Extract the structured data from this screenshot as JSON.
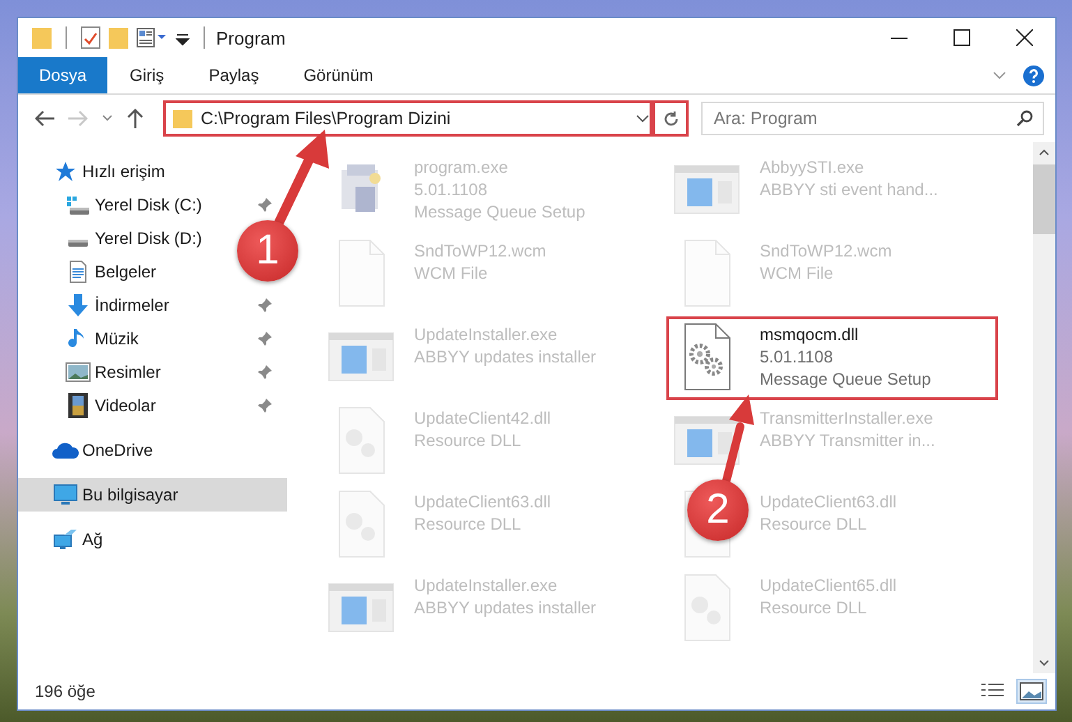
{
  "window": {
    "title": "Program"
  },
  "ribbon": {
    "tabs": [
      {
        "label": "Dosya",
        "selected": true
      },
      {
        "label": "Giriş",
        "selected": false
      },
      {
        "label": "Paylaş",
        "selected": false
      },
      {
        "label": "Görünüm",
        "selected": false
      }
    ]
  },
  "address_bar": {
    "path": "C:\\Program Files\\Program Dizini",
    "highlighted": true
  },
  "search": {
    "placeholder": "Ara: Program"
  },
  "nav_pane": {
    "items": [
      {
        "label": "Hızlı erişim",
        "kind": "star",
        "pinned": false,
        "selected": false,
        "children": [
          {
            "label": "Yerel Disk (C:)",
            "kind": "system-drive",
            "pinned": true,
            "selected": false
          },
          {
            "label": "Yerel Disk (D:)",
            "kind": "drive",
            "selected": false
          },
          {
            "label": "Belgeler",
            "kind": "documents",
            "selected": false
          },
          {
            "label": "İndirmeler",
            "kind": "downloads",
            "pinned": true,
            "selected": false
          },
          {
            "label": "Müzik",
            "kind": "music",
            "pinned": true,
            "selected": false
          },
          {
            "label": "Resimler",
            "kind": "pictures",
            "pinned": true,
            "selected": false
          },
          {
            "label": "Videolar",
            "kind": "videos",
            "pinned": true,
            "selected": false
          }
        ]
      },
      {
        "label": "OneDrive",
        "kind": "cloud",
        "pinned": false,
        "selected": false
      },
      {
        "label": "Bu bilgisayar",
        "kind": "computer",
        "pinned": false,
        "selected": true
      },
      {
        "label": "Ağ",
        "kind": "network",
        "pinned": false,
        "selected": false
      }
    ]
  },
  "files": [
    {
      "name": "program.exe",
      "details": [
        "5.01.1108",
        "Message Queue Setup"
      ],
      "kind": "setup",
      "blurred": true,
      "highlighted": false
    },
    {
      "name": "AbbyySTI.exe",
      "details": [
        "ABBYY sti event hand..."
      ],
      "kind": "app",
      "blurred": true,
      "highlighted": false
    },
    {
      "name": "SndToWP12.wcm",
      "details": [
        "WCM File"
      ],
      "kind": "blank",
      "blurred": true,
      "highlighted": false
    },
    {
      "name": "SndToWP12.wcm",
      "details": [
        "WCM File"
      ],
      "kind": "blank",
      "blurred": true,
      "highlighted": false
    },
    {
      "name": "UpdateInstaller.exe",
      "details": [
        "ABBYY updates installer"
      ],
      "kind": "app",
      "blurred": true,
      "highlighted": false
    },
    {
      "name": "msmqocm.dll",
      "details": [
        "5.01.1108",
        "Message Queue Setup"
      ],
      "kind": "gear",
      "blurred": false,
      "highlighted": true
    },
    {
      "name": "UpdateClient42.dll",
      "details": [
        "Resource DLL"
      ],
      "kind": "key",
      "blurred": true,
      "highlighted": false
    },
    {
      "name": "TransmitterInstaller.exe",
      "details": [
        "ABBYY Transmitter in..."
      ],
      "kind": "app",
      "blurred": true,
      "highlighted": false
    },
    {
      "name": "UpdateClient63.dll",
      "details": [
        "Resource DLL"
      ],
      "kind": "key",
      "blurred": true,
      "highlighted": false
    },
    {
      "name": "UpdateClient63.dll",
      "details": [
        "Resource DLL"
      ],
      "kind": "key",
      "blurred": true,
      "highlighted": false
    },
    {
      "name": "UpdateInstaller.exe",
      "details": [
        "ABBYY updates installer"
      ],
      "kind": "app",
      "blurred": true,
      "highlighted": false
    },
    {
      "name": "UpdateClient65.dll",
      "details": [
        "Resource DLL"
      ],
      "kind": "key",
      "blurred": true,
      "highlighted": false
    }
  ],
  "status_bar": {
    "item_count": "196 öğe",
    "view_buttons": [
      {
        "kind": "details",
        "selected": false
      },
      {
        "kind": "large-icons",
        "selected": true
      }
    ]
  },
  "annotations": [
    {
      "label": "1"
    },
    {
      "label": "2"
    }
  ]
}
